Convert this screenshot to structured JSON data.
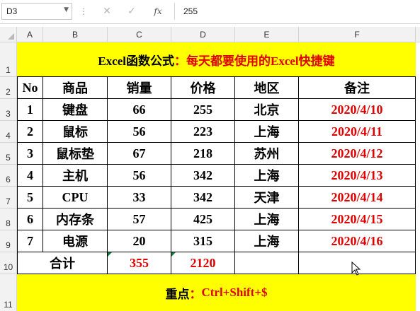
{
  "formula_bar": {
    "name_box": "D3",
    "separator": "⋮",
    "cancel_icon": "✕",
    "enter_icon": "✓",
    "function_icon": "fx",
    "formula": "255"
  },
  "columns": [
    "A",
    "B",
    "C",
    "D",
    "E",
    "F"
  ],
  "rows": [
    "1",
    "2",
    "3",
    "4",
    "5",
    "6",
    "7",
    "8",
    "9",
    "10",
    "11"
  ],
  "sheet": {
    "title_part1": "Excel函数公式",
    "title_colon": "：",
    "title_part2": "每天都要使用的Excel快捷键",
    "headers": [
      "No",
      "商品",
      "销量",
      "价格",
      "地区",
      "备注"
    ],
    "data_rows": [
      [
        "1",
        "键盘",
        "66",
        "255",
        "北京",
        "2020/4/10"
      ],
      [
        "2",
        "鼠标",
        "56",
        "223",
        "上海",
        "2020/4/11"
      ],
      [
        "3",
        "鼠标垫",
        "67",
        "218",
        "苏州",
        "2020/4/12"
      ],
      [
        "4",
        "主机",
        "56",
        "342",
        "上海",
        "2020/4/13"
      ],
      [
        "5",
        "CPU",
        "33",
        "342",
        "天津",
        "2020/4/14"
      ],
      [
        "6",
        "内存条",
        "57",
        "425",
        "上海",
        "2020/4/15"
      ],
      [
        "7",
        "电源",
        "20",
        "315",
        "上海",
        "2020/4/16"
      ]
    ],
    "total": {
      "label": "合计",
      "sales": "355",
      "price": "2120",
      "region": "",
      "note": ""
    },
    "footer_label": "重点",
    "footer_colon": "：",
    "footer_shortcut": "Ctrl+Shift+$"
  },
  "colors": {
    "highlight": "#ffff00",
    "accent_red": "#e00000",
    "error_indicator": "#107c41"
  }
}
